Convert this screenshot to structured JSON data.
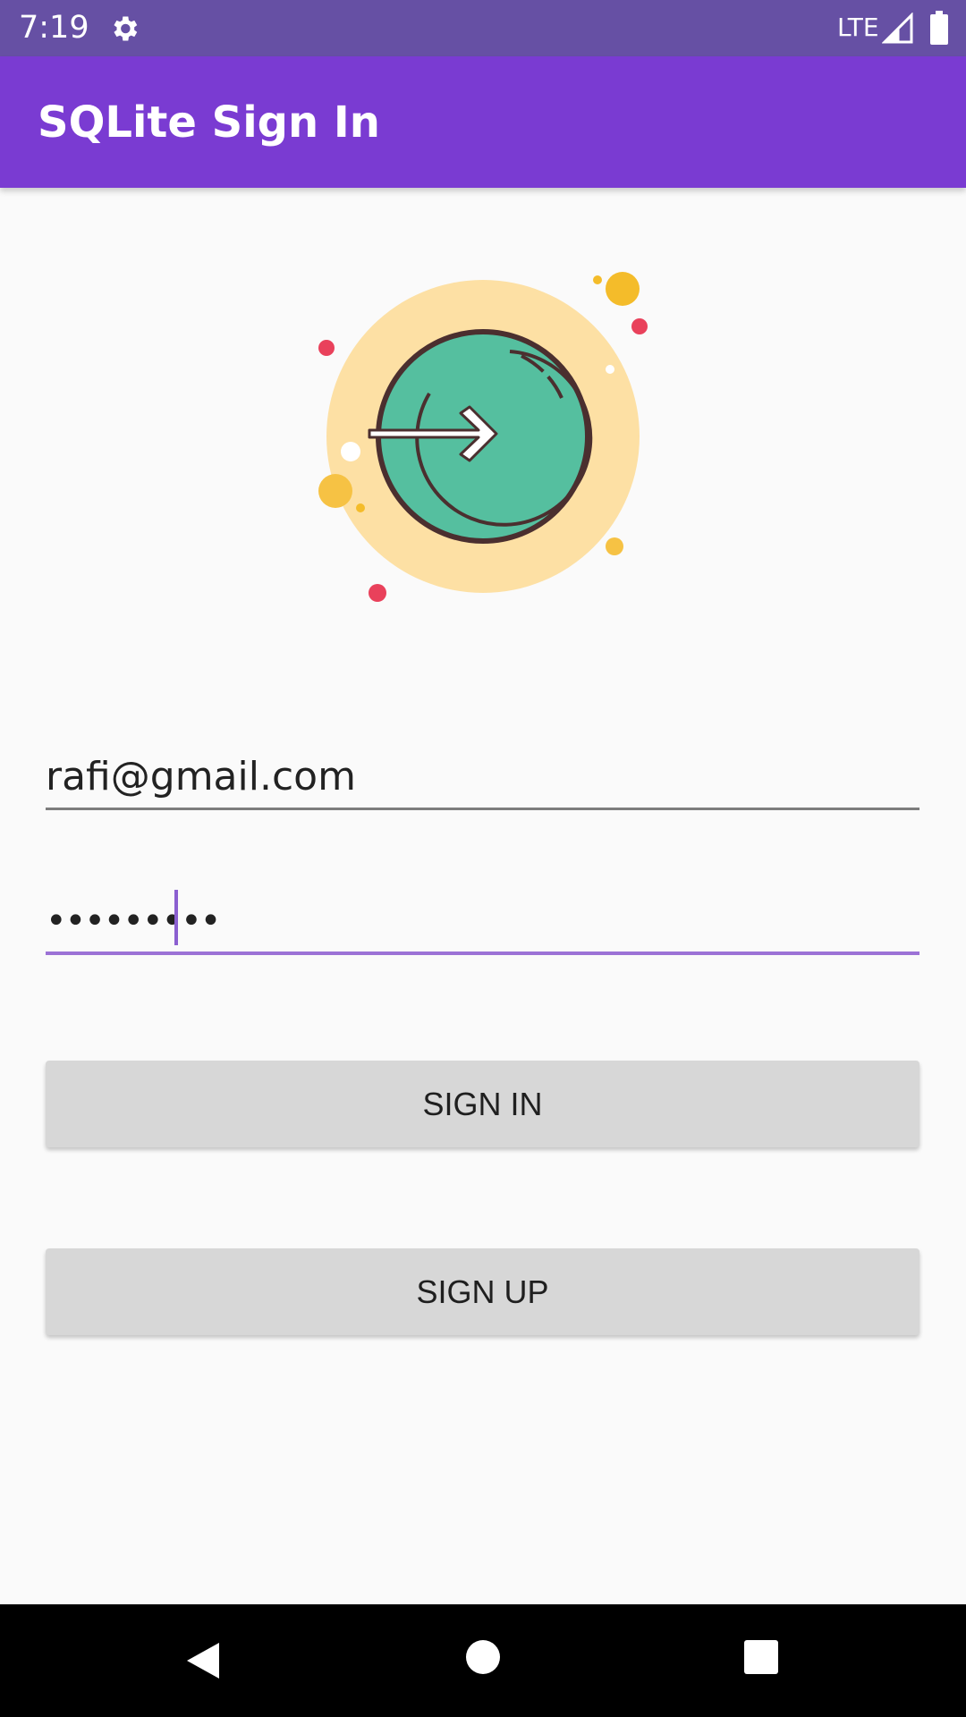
{
  "status_bar": {
    "time": "7:19",
    "network": "LTE",
    "background_color": "#6650a4",
    "icons": [
      "gear-icon",
      "signal-icon",
      "battery-icon"
    ]
  },
  "app_bar": {
    "title": "SQLite Sign In",
    "background_color": "#7a3bd2"
  },
  "hero": {
    "icon": "sign-in-arrow-icon",
    "colors": {
      "circle_bg": "#fde0a4",
      "button": "#55bf9f",
      "outline": "#4b2f2f",
      "dot_red": "#e9415b",
      "dot_yellow": "#f6c244"
    }
  },
  "form": {
    "email": {
      "value": "rafi@gmail.com"
    },
    "password": {
      "masked_value": "•••••••••",
      "focused": true
    },
    "accent_color": "#9c72d6"
  },
  "buttons": {
    "sign_in": "SIGN IN",
    "sign_up": "SIGN UP",
    "color": "#d7d7d7"
  },
  "nav_bar": {
    "icons": [
      "back-icon",
      "home-icon",
      "recents-icon"
    ]
  }
}
